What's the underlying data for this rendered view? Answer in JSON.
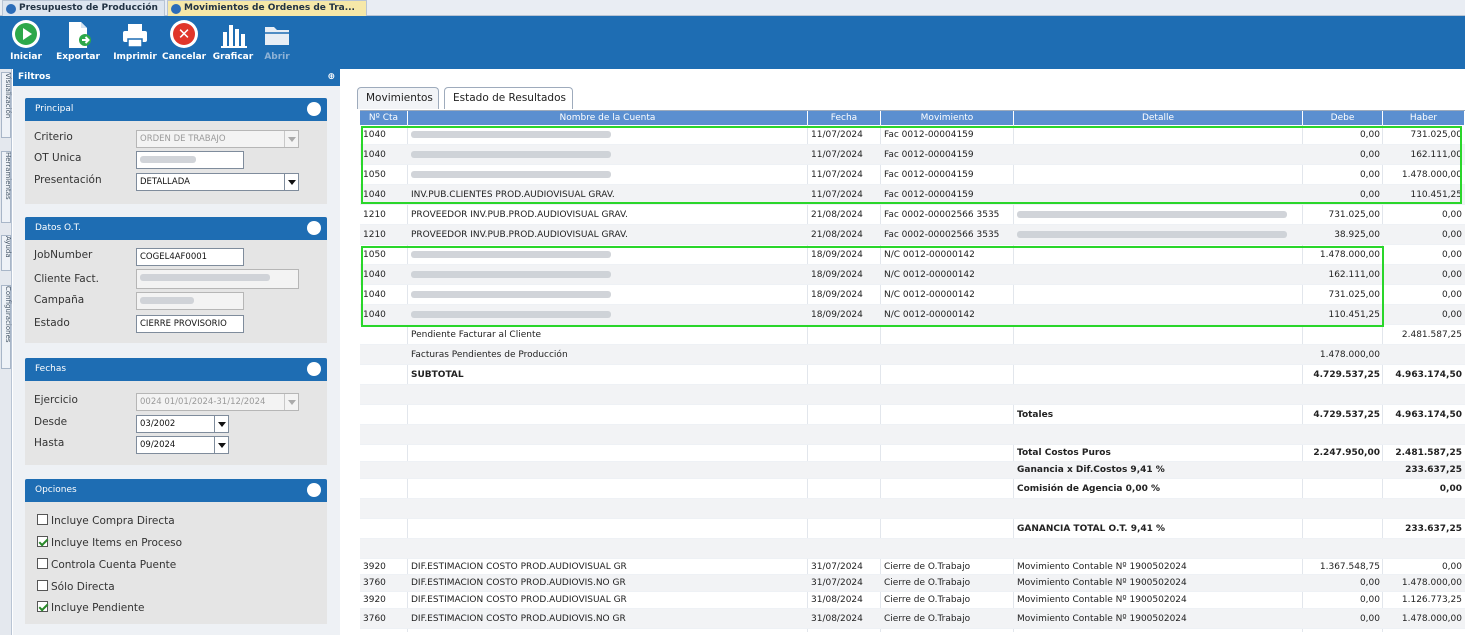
{
  "doc_tabs": [
    "Presupuesto de Producción",
    "Movimientos de Ordenes de Tra..."
  ],
  "toolbar": {
    "iniciar": "Iniciar",
    "exportar": "Exportar",
    "imprimir": "Imprimir",
    "cancelar": "Cancelar",
    "graficar": "Graficar",
    "abrir": "Abrir"
  },
  "side_tabs": [
    "Visualización",
    "Herramientas",
    "Ayuda",
    "Configuraciones"
  ],
  "filters": {
    "title": "Filtros",
    "pin": "⊕",
    "principal": {
      "title": "Principal",
      "criterio_label": "Criterio",
      "criterio_value": "ORDEN DE TRABAJO",
      "ot_unica_label": "OT Unica",
      "presentacion_label": "Presentación",
      "presentacion_value": "DETALLADA"
    },
    "datos": {
      "title": "Datos O.T.",
      "jobnumber_label": "JobNumber",
      "jobnumber_value": "COGEL4AF0001",
      "cliente_label": "Cliente Fact.",
      "campana_label": "Campaña",
      "estado_label": "Estado",
      "estado_value": "CIERRE PROVISORIO"
    },
    "fechas": {
      "title": "Fechas",
      "ejercicio_label": "Ejercicio",
      "ejercicio_value": "0024 01/01/2024-31/12/2024",
      "desde_label": "Desde",
      "desde_value": "03/2002",
      "hasta_label": "Hasta",
      "hasta_value": "09/2024"
    },
    "opciones": {
      "title": "Opciones",
      "items": [
        {
          "label": "Incluye Compra Directa",
          "checked": false
        },
        {
          "label": "Incluye Items en Proceso",
          "checked": true
        },
        {
          "label": "Controla Cuenta Puente",
          "checked": false
        },
        {
          "label": "Sólo Directa",
          "checked": false
        },
        {
          "label": "Incluye Pendiente",
          "checked": true
        }
      ]
    }
  },
  "result_tabs": [
    "Movimientos",
    "Estado de Resultados"
  ],
  "grid": {
    "columns": [
      "Nº Cta",
      "Nombre de la Cuenta",
      "Fecha",
      "Movimiento",
      "Detalle",
      "Debe",
      "Haber"
    ],
    "rows": [
      {
        "cta": "1040",
        "nombre": "",
        "fecha": "11/07/2024",
        "mov": "Fac 0012-00004159",
        "detalle": "",
        "debe": "0,00",
        "haber": "731.025,00",
        "blurName": true
      },
      {
        "cta": "1040",
        "nombre": "",
        "fecha": "11/07/2024",
        "mov": "Fac 0012-00004159",
        "detalle": "",
        "debe": "0,00",
        "haber": "162.111,00",
        "blurName": true
      },
      {
        "cta": "1050",
        "nombre": "",
        "fecha": "11/07/2024",
        "mov": "Fac 0012-00004159",
        "detalle": "",
        "debe": "0,00",
        "haber": "1.478.000,00",
        "blurName": true
      },
      {
        "cta": "1040",
        "nombre": "INV.PUB.CLIENTES PROD.AUDIOVISUAL GRAV.",
        "fecha": "11/07/2024",
        "mov": "Fac 0012-00004159",
        "detalle": "",
        "debe": "0,00",
        "haber": "110.451,25"
      },
      {
        "cta": "1210",
        "nombre": "PROVEEDOR INV.PUB.PROD.AUDIOVISUAL GRAV.",
        "fecha": "21/08/2024",
        "mov": "Fac 0002-00002566 3535",
        "detalle": "",
        "debe": "731.025,00",
        "haber": "0,00",
        "blurDetail": true
      },
      {
        "cta": "1210",
        "nombre": "PROVEEDOR INV.PUB.PROD.AUDIOVISUAL GRAV.",
        "fecha": "21/08/2024",
        "mov": "Fac 0002-00002566 3535",
        "detalle": "",
        "debe": "38.925,00",
        "haber": "0,00",
        "blurDetail": true
      },
      {
        "cta": "1050",
        "nombre": "",
        "fecha": "18/09/2024",
        "mov": "N/C 0012-00000142",
        "detalle": "",
        "debe": "1.478.000,00",
        "haber": "0,00",
        "blurName": true
      },
      {
        "cta": "1040",
        "nombre": "",
        "fecha": "18/09/2024",
        "mov": "N/C 0012-00000142",
        "detalle": "",
        "debe": "162.111,00",
        "haber": "0,00",
        "blurName": true
      },
      {
        "cta": "1040",
        "nombre": "",
        "fecha": "18/09/2024",
        "mov": "N/C 0012-00000142",
        "detalle": "",
        "debe": "731.025,00",
        "haber": "0,00",
        "blurName": true
      },
      {
        "cta": "1040",
        "nombre": "",
        "fecha": "18/09/2024",
        "mov": "N/C 0012-00000142",
        "detalle": "",
        "debe": "110.451,25",
        "haber": "0,00",
        "blurName": true
      },
      {
        "cta": "",
        "nombre": "Pendiente Facturar al Cliente",
        "fecha": "",
        "mov": "",
        "detalle": "",
        "debe": "",
        "haber": "2.481.587,25"
      },
      {
        "cta": "",
        "nombre": "Facturas Pendientes de Producción",
        "fecha": "",
        "mov": "",
        "detalle": "",
        "debe": "1.478.000,00",
        "haber": ""
      },
      {
        "cta": "",
        "nombre": "SUBTOTAL",
        "fecha": "",
        "mov": "",
        "detalle": "",
        "debe": "4.729.537,25",
        "haber": "4.963.174,50",
        "bold": true
      },
      {
        "cta": "",
        "nombre": "",
        "fecha": "",
        "mov": "",
        "detalle": "",
        "debe": "",
        "haber": ""
      },
      {
        "cta": "",
        "nombre": "",
        "fecha": "",
        "mov": "",
        "detalle": "Totales",
        "debe": "4.729.537,25",
        "haber": "4.963.174,50",
        "bold": true
      },
      {
        "cta": "",
        "nombre": "",
        "fecha": "",
        "mov": "",
        "detalle": "",
        "debe": "",
        "haber": ""
      },
      {
        "cta": "",
        "nombre": "",
        "fecha": "",
        "mov": "",
        "detalle": "Total Costos Puros",
        "debe": "2.247.950,00",
        "haber": "2.481.587,25",
        "bold": true,
        "h": 17
      },
      {
        "cta": "",
        "nombre": "",
        "fecha": "",
        "mov": "",
        "detalle": "Ganancia x Dif.Costos 9,41 %",
        "debe": "",
        "haber": "233.637,25",
        "bold": true,
        "h": 17
      },
      {
        "cta": "",
        "nombre": "",
        "fecha": "",
        "mov": "",
        "detalle": "Comisión de Agencia 0,00 %",
        "debe": "",
        "haber": "0,00",
        "bold": true
      },
      {
        "cta": "",
        "nombre": "",
        "fecha": "",
        "mov": "",
        "detalle": "",
        "debe": "",
        "haber": ""
      },
      {
        "cta": "",
        "nombre": "",
        "fecha": "",
        "mov": "",
        "detalle": "GANANCIA TOTAL O.T. 9,41 %",
        "debe": "",
        "haber": "233.637,25",
        "bold": true
      },
      {
        "cta": "",
        "nombre": "",
        "fecha": "",
        "mov": "",
        "detalle": "",
        "debe": "",
        "haber": ""
      },
      {
        "cta": "3920",
        "nombre": "DIF.ESTIMACION COSTO PROD.AUDIOVISUAL GR",
        "fecha": "31/07/2024",
        "mov": "Cierre de O.Trabajo",
        "detalle": "Movimiento Contable Nº 1900502024",
        "debe": "1.367.548,75",
        "haber": "0,00",
        "h": 16
      },
      {
        "cta": "3760",
        "nombre": "DIF.ESTIMACION COSTO PROD.AUDIOVIS.NO GR",
        "fecha": "31/07/2024",
        "mov": "Cierre de O.Trabajo",
        "detalle": "Movimiento Contable Nº 1900502024",
        "debe": "0,00",
        "haber": "1.478.000,00",
        "h": 17
      },
      {
        "cta": "3920",
        "nombre": "DIF.ESTIMACION COSTO PROD.AUDIOVISUAL GR",
        "fecha": "31/08/2024",
        "mov": "Cierre de O.Trabajo",
        "detalle": "Movimiento Contable Nº 1900502024",
        "debe": "0,00",
        "haber": "1.126.773,25",
        "h": 17
      },
      {
        "cta": "3760",
        "nombre": "DIF.ESTIMACION COSTO PROD.AUDIOVIS.NO GR",
        "fecha": "31/08/2024",
        "mov": "Cierre de O.Trabajo",
        "detalle": "Movimiento Contable Nº 1900502024",
        "debe": "0,00",
        "haber": "1.478.000,00",
        "h": 20
      }
    ]
  }
}
